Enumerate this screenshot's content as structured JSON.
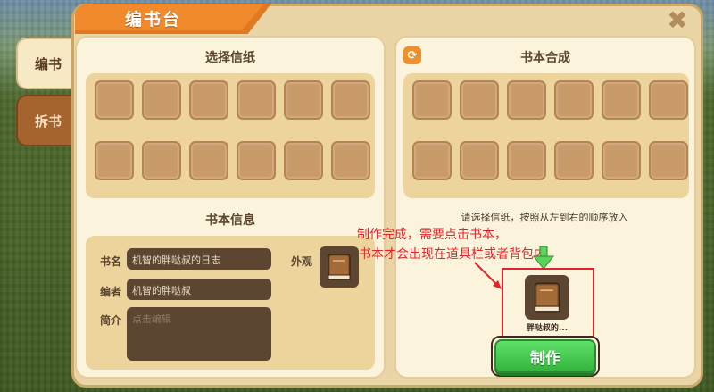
{
  "tabs": {
    "compose": "编书",
    "disassemble": "拆书"
  },
  "window": {
    "title": "编书台",
    "close_glyph": "✖"
  },
  "left_panel": {
    "select_paper_title": "选择信纸",
    "book_info_title": "书本信息",
    "slots_count": 12,
    "fields": {
      "name_label": "书名",
      "name_value": "机智的胖哒叔的日志",
      "author_label": "编者",
      "author_value": "机智的胖哒叔",
      "intro_label": "简介",
      "intro_placeholder": "点击编辑",
      "cover_label": "外观"
    }
  },
  "right_panel": {
    "compose_title": "书本合成",
    "refresh_icon": "refresh-icon",
    "slots_count": 12,
    "hint": "请选择信纸，按照从左到右的顺序放入",
    "annotation_line1": "制作完成，需要点击书本，",
    "annotation_line2": "书本才会出现在道具栏或者背包内",
    "result_label": "胖哒叔的...",
    "make_button": "制作"
  },
  "colors": {
    "accent_orange": "#f08a2c",
    "slot_brown": "#c99a6a",
    "field_dark": "#5c4632",
    "button_green": "#33b53c",
    "annotation_red": "#e0262a"
  }
}
